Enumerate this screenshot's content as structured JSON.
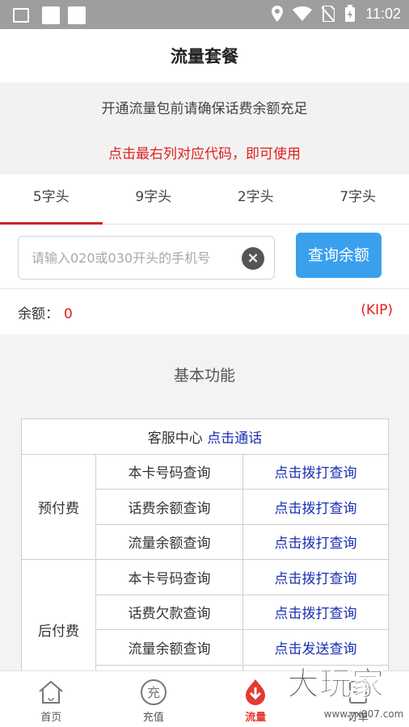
{
  "status_bar": {
    "time": "11:02"
  },
  "header": {
    "title": "流量套餐"
  },
  "notice": {
    "line1": "开通流量包前请确保话费余额充足",
    "line2": "点击最右列对应代码，即可使用"
  },
  "tabs": [
    {
      "label": "5字头",
      "active": true
    },
    {
      "label": "9字头"
    },
    {
      "label": "2字头"
    },
    {
      "label": "7字头"
    }
  ],
  "search": {
    "placeholder": "请输入020或030开头的手机号",
    "clear_icon": "×",
    "button_label": "查询余额"
  },
  "balance": {
    "label": "余额：",
    "value": "0",
    "unit": "(KIP)"
  },
  "functions": {
    "title": "基本功能",
    "service": {
      "label": "客服中心",
      "link": "点击通话"
    },
    "prepaid": {
      "category": "预付费",
      "rows": [
        {
          "item": "本卡号码查询",
          "action": "点击拨打查询"
        },
        {
          "item": "话费余额查询",
          "action": "点击拨打查询"
        },
        {
          "item": "流量余额查询",
          "action": "点击拨打查询"
        }
      ]
    },
    "postpaid": {
      "category": "后付费",
      "rows": [
        {
          "item": "本卡号码查询",
          "action": "点击拨打查询"
        },
        {
          "item": "话费欠款查询",
          "action": "点击拨打查询"
        },
        {
          "item": "流量余额查询",
          "action": "点击发送查询"
        }
      ]
    }
  },
  "bottom_nav": [
    {
      "label": "首页",
      "icon": "home-icon"
    },
    {
      "label": "充值",
      "icon": "recharge-icon",
      "icon_text": "充"
    },
    {
      "label": "流量",
      "icon": "data-flow-icon",
      "active": true
    },
    {
      "label": "订单",
      "icon": "order-icon"
    }
  ],
  "watermark": {
    "text": "大玩家",
    "url": "www.yx007.com"
  },
  "colors": {
    "accent_red": "#e02020",
    "tab_underline": "#c62828",
    "button_blue": "#3aa0ee",
    "link_blue": "#1a2fb0"
  }
}
